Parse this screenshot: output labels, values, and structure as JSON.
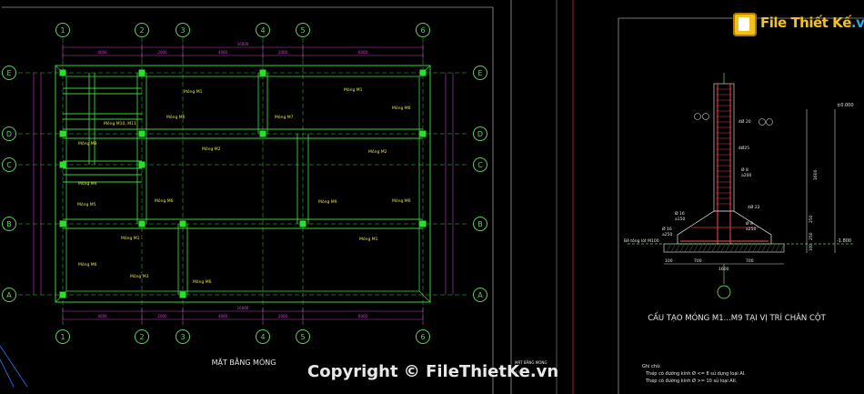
{
  "drawing": {
    "plan_title": "MẶT BẰNG MÓNG",
    "detail_title": "CẤU TẠO MÓNG M1...M9 TẠI VỊ TRÍ CHÂN CỘT",
    "small_title": "MẶT BẰNG MÓNG",
    "small_scale": "1:75",
    "notes_heading": "Ghi chú:",
    "note_1": "Thép có đường kính Ø <= 8 sử dụng loại AI.",
    "note_2": "Thép có đường kính Ø >= 10 sử loại AII."
  },
  "axes": {
    "columns": [
      "1",
      "2",
      "3",
      "4",
      "5",
      "6"
    ],
    "rows": [
      "E",
      "D",
      "C",
      "B",
      "A"
    ]
  },
  "dimensions": {
    "total": "16000",
    "spans": [
      "4000",
      "2000",
      "4000",
      "2000",
      "6000"
    ]
  },
  "beam_labels": {
    "top_left": "Móng M1",
    "top_right": "Móng M1",
    "m6_a": "Móng M6",
    "m6_b": "Móng M6",
    "m6_c": "Móng M6",
    "m6_d": "Móng M6",
    "m6_e": "Móng M6",
    "m6_f": "Móng M6",
    "m7": "Móng M7",
    "m10": "Móng M10, M11",
    "m8": "Móng M8",
    "m2_a": "Móng M2",
    "m2_b": "Móng M2",
    "m4": "Móng M4",
    "m5": "Móng M5",
    "m9": "Móng M9",
    "m1_bottom_a": "Móng M1",
    "m1_bottom_b": "Móng M1",
    "m3": "Móng M3",
    "m6_bottom": "Móng M6"
  },
  "detail": {
    "level_top": "±0.000",
    "level_bottom": "-1.800",
    "rebar_1": "4Ø 20",
    "rebar_2": "4Ø25",
    "rebar_3": "Ø 8",
    "rebar_4": "a200",
    "rebar_5": "Ø 16",
    "rebar_6": "a150",
    "rebar_7": "4Ø 22",
    "rebar_8": "Ø 8",
    "rebar_9": "a250",
    "rebar_10": "Ø 16",
    "rebar_11": "a250",
    "lean_concrete": "Bê tông lót M100",
    "dim_100": "100",
    "dim_700a": "700",
    "dim_700b": "700",
    "dim_1600": "1600",
    "dim_v1": "1600",
    "dim_v2": "250",
    "dim_v3": "250",
    "dim_v4": "100"
  },
  "brand": {
    "file": "File",
    "thiet": "Thiết",
    "ke": "Kế",
    "vn": ".vn"
  },
  "watermark": "Copyright © FileThietKe.vn"
}
